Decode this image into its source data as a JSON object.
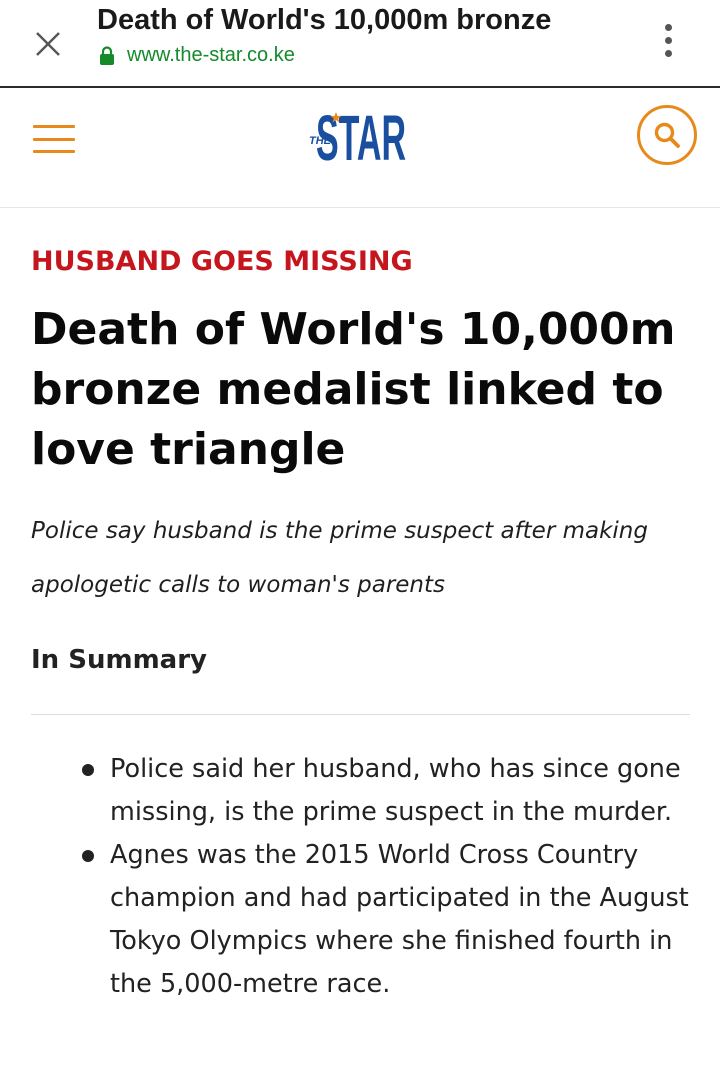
{
  "browser": {
    "page_title": "Death of World's 10,000m bronze",
    "url": "www.the-star.co.ke"
  },
  "header": {
    "logo_small": "THE",
    "logo_main": "STAR"
  },
  "article": {
    "kicker": "HUSBAND GOES MISSING",
    "headline": "Death of World's 10,000m bronze medalist linked to love triangle",
    "standfirst": "Police say husband is the prime suspect after making apologetic calls to woman's parents",
    "summary_heading": "In Summary",
    "summary_items": [
      "Police said her husband, who has since gone missing, is the prime suspect in the murder.",
      "Agnes was the 2015 World Cross Country champion and had participated in the August Tokyo Olympics where she finished fourth in the 5,000-metre race."
    ]
  },
  "icons": {
    "close": "close-icon",
    "lock": "lock-icon",
    "menu": "more-vert-icon",
    "hamburger": "hamburger-menu-icon",
    "search": "search-icon"
  },
  "colors": {
    "accent_orange": "#e8891c",
    "kicker_red": "#c4161c",
    "logo_blue": "#1a4fa0",
    "url_green": "#148a2b"
  }
}
